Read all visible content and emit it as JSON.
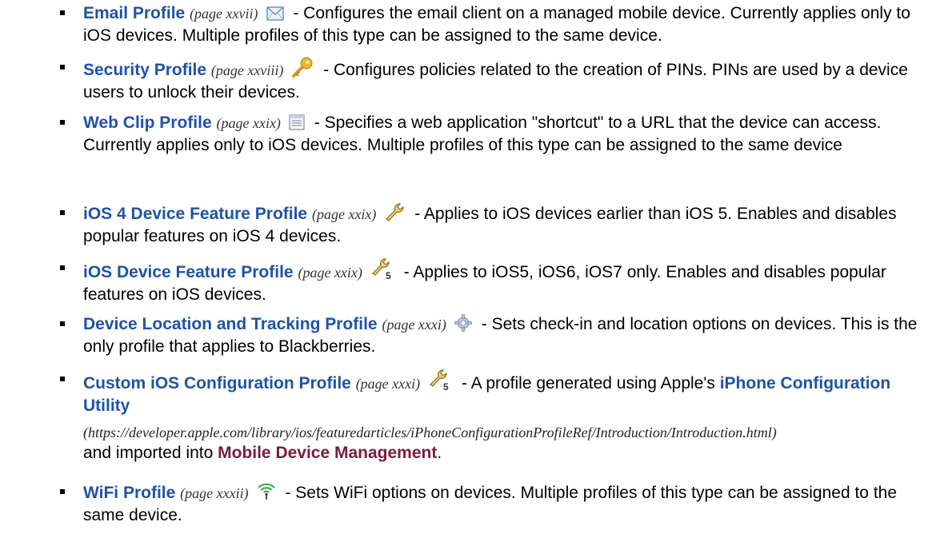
{
  "items": [
    {
      "title": "Email Profile",
      "page_ref": "(page xxvii)",
      "icon": "envelope-icon",
      "description": " - Configures the email client on a managed mobile device. Currently applies only to iOS devices. Multiple profiles of this type can be assigned to the same device."
    },
    {
      "title": "Security Profile",
      "page_ref": "(page xxviii)",
      "icon": "key-icon",
      "description": " - Configures policies related to the creation of PINs. PINs are used by a device users to unlock their devices."
    },
    {
      "title": "Web Clip Profile",
      "page_ref": "(page xxix)",
      "icon": "web-clip-icon",
      "description": " - Specifies a web application \"shortcut\" to a URL that the device can access. Currently applies only to iOS devices. Multiple profiles of this type can be assigned to the same device"
    },
    {
      "title": "iOS 4 Device Feature Profile",
      "page_ref": "(page xxix)",
      "icon": "wrench-icon",
      "description": " - Applies to iOS devices earlier than iOS 5. Enables and disables popular features on iOS 4 devices."
    },
    {
      "title": "iOS Device Feature Profile",
      "page_ref": "(page xxix)",
      "icon": "wrench-5-icon",
      "description": " - Applies to iOS5, iOS6, iOS7 only. Enables and disables popular features on iOS devices."
    },
    {
      "title": "Device Location and Tracking Profile",
      "page_ref": "(page xxxi)",
      "icon": "gear-icon",
      "description": " - Sets check-in and location options on devices. This is the only profile that applies to Blackberries."
    },
    {
      "title": "Custom iOS Configuration Profile",
      "page_ref": "(page xxxi)",
      "icon": "wrench-5-icon",
      "description_pre": " - A profile generated using Apple's ",
      "utility_link": "iPhone Configuration Utility",
      "url": "(https://developer.apple.com/library/ios/featuredarticles/iPhoneConfigurationProfileRef/Introduction/Introduction.html)",
      "description_mid": " and imported into ",
      "product": "Mobile Device Management",
      "description_end": "."
    },
    {
      "title": "WiFi Profile",
      "page_ref": "(page xxxii)",
      "icon": "wifi-icon",
      "description": " - Sets WiFi options on devices. Multiple profiles of this type can be assigned to the same device."
    }
  ]
}
